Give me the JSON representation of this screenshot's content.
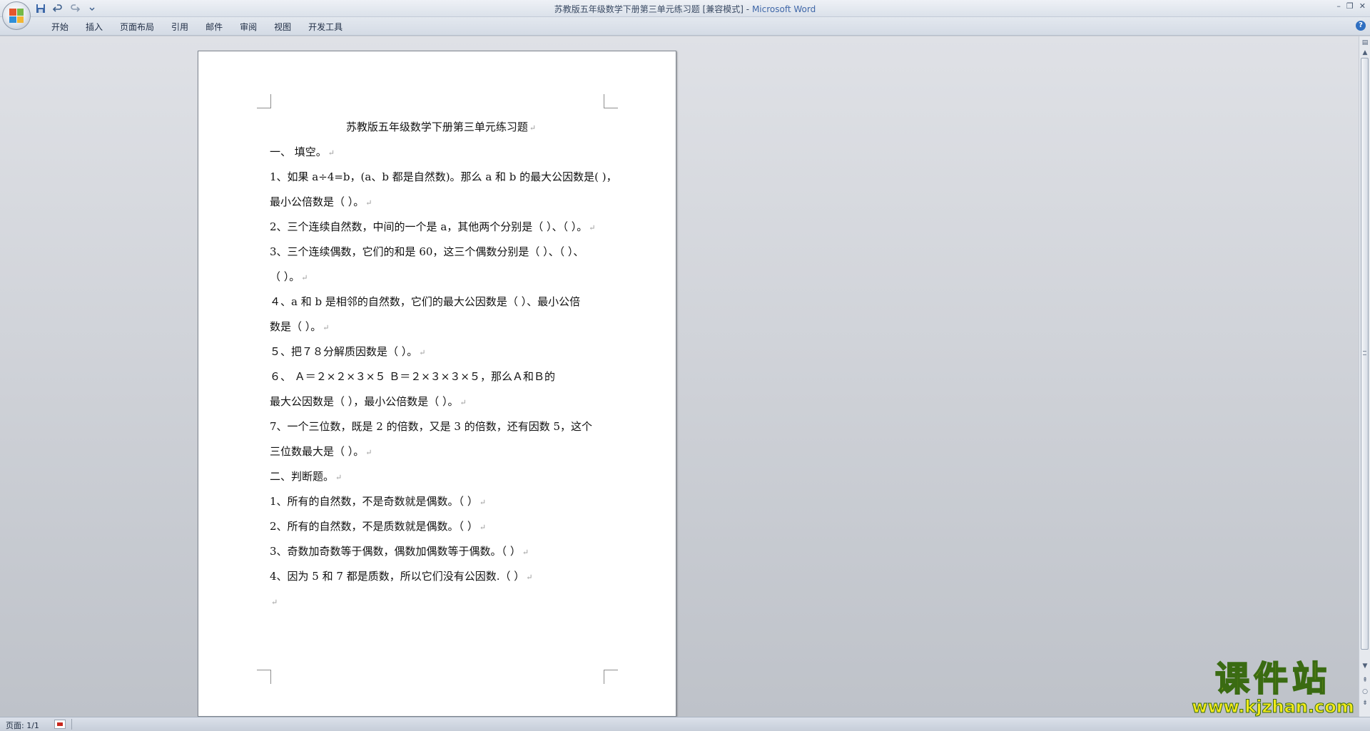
{
  "window": {
    "title": "苏教版五年级数学下册第三单元练习题 [兼容模式]",
    "separator": " - ",
    "app_name": "Microsoft Word"
  },
  "quick_access": {
    "save_icon": "save-icon",
    "undo_icon": "undo-icon",
    "redo_icon": "redo-icon",
    "customize_icon": "chevron-down-icon"
  },
  "ribbon": {
    "tabs": [
      "开始",
      "插入",
      "页面布局",
      "引用",
      "邮件",
      "审阅",
      "视图",
      "开发工具"
    ],
    "help_label": "?"
  },
  "document": {
    "lines": [
      {
        "text": "苏教版五年级数学下册第三单元练习题",
        "align": "center"
      },
      {
        "text": "一、 填空。"
      },
      {
        "text": "1、如果 a÷4=b，(a、b 都是自然数)。那么 a 和 b 的最大公因数是(    )，",
        "nomark": true
      },
      {
        "text": "最小公倍数是（    ）。"
      },
      {
        "text": "2、三个连续自然数，中间的一个是 a，其他两个分别是（  ）、（  ）。"
      },
      {
        "text": "3、三个连续偶数，它们的和是 60，这三个偶数分别是（  ）、（  ）、",
        "nomark": true
      },
      {
        "text": "（  ）。"
      },
      {
        "text": "４、a 和 b 是相邻的自然数，它们的最大公因数是（  ）、最小公倍",
        "nomark": true
      },
      {
        "text": "数是（  ）。"
      },
      {
        "text": "５、把７８分解质因数是（                            ）。"
      },
      {
        "text": "６、  Ａ＝２×２×３×５     Ｂ＝２×３×３×５，那么Ａ和Ｂ的",
        "nomark": true
      },
      {
        "text": "最大公因数是（    ），最小公倍数是（   ）。"
      },
      {
        "text": "7、一个三位数，既是 2 的倍数，又是 3 的倍数，还有因数 5，这个",
        "nomark": true
      },
      {
        "text": "三位数最大是（      ）。"
      },
      {
        "text": "二、判断题。"
      },
      {
        "text": "1、所有的自然数，不是奇数就是偶数。（   ）"
      },
      {
        "text": "2、所有的自然数，不是质数就是偶数。（   ）"
      },
      {
        "text": "3、奇数加奇数等于偶数，偶数加偶数等于偶数。（   ）"
      },
      {
        "text": "4、因为 5 和 7 都是质数，所以它们没有公因数.（   ）"
      },
      {
        "text": ""
      }
    ],
    "paragraph_mark": "↵"
  },
  "status_bar": {
    "page_info": "页面: 1/1"
  },
  "watermark": {
    "title": "课件站",
    "url": "www.kjzhan.com"
  },
  "colors": {
    "office_logo": [
      "#e4572e",
      "#76b947",
      "#2f8fd8",
      "#f2b632"
    ]
  }
}
